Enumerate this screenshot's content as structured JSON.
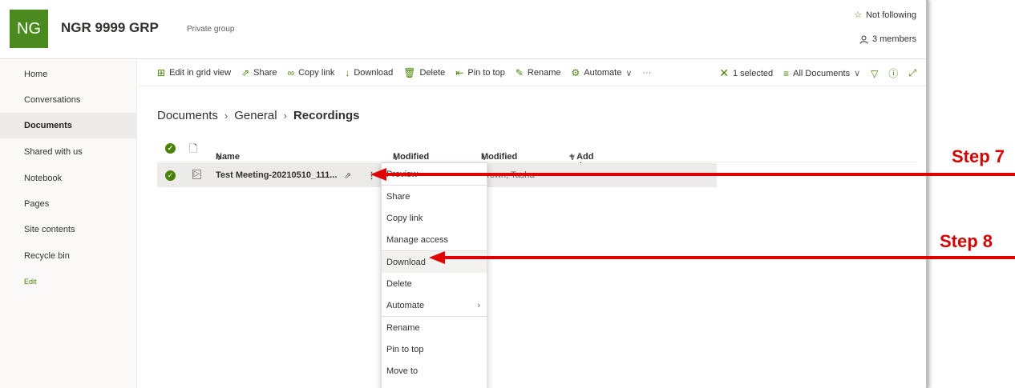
{
  "header": {
    "logo_text": "NG",
    "group_name": "NGR 9999 GRP",
    "group_type": "Private group",
    "follow_label": "Not following",
    "members_label": "3 members"
  },
  "leftnav": {
    "items": [
      {
        "label": "Home"
      },
      {
        "label": "Conversations"
      },
      {
        "label": "Documents"
      },
      {
        "label": "Shared with us"
      },
      {
        "label": "Notebook"
      },
      {
        "label": "Pages"
      },
      {
        "label": "Site contents"
      },
      {
        "label": "Recycle bin"
      }
    ],
    "edit_label": "Edit"
  },
  "commandbar": {
    "edit_grid": "Edit in grid view",
    "share": "Share",
    "copy_link": "Copy link",
    "download": "Download",
    "delete": "Delete",
    "pin_to_top": "Pin to top",
    "rename": "Rename",
    "automate": "Automate",
    "more": "···",
    "selected": "1 selected",
    "view": "All Documents"
  },
  "breadcrumb": {
    "items": [
      "Documents",
      "General",
      "Recordings"
    ]
  },
  "list": {
    "columns": {
      "name": "Name",
      "modified": "Modified",
      "modified_by": "Modified By",
      "add_column": "+ Add column"
    },
    "rows": [
      {
        "name": "Test Meeting-20210510_111...",
        "modified_by": "Brown, Tasha"
      }
    ]
  },
  "context_menu": {
    "items": [
      "Preview",
      "Share",
      "Copy link",
      "Manage access",
      "Download",
      "Delete",
      "Automate",
      "Rename",
      "Pin to top",
      "Move to",
      "Copy to"
    ]
  },
  "annotations": {
    "step7": "Step 7",
    "step8": "Step 8",
    "arrow_color": "#e00000"
  },
  "colors": {
    "accent": "#498205",
    "logo_bg": "#4b8a1e"
  }
}
